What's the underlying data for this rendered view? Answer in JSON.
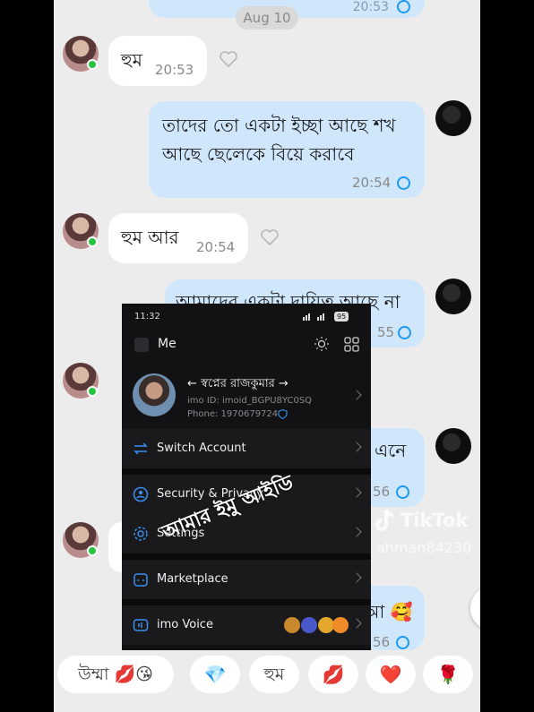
{
  "chat": {
    "date_label": "Aug 10",
    "top_bubble_time": "20:53",
    "messages": [
      {
        "text": "হুম",
        "time": "20:53"
      },
      {
        "line1": "তাদের তো একটা ইচ্ছা আছে শখ",
        "line2": "আছে ছেলেকে বিয়ে করাবে",
        "time": "20:54"
      },
      {
        "text": "হুম আর",
        "time": "20:54"
      },
      {
        "text": "আমাদের একটা দায়িত্ব আছে না",
        "time": "55"
      },
      {
        "text": "এনে",
        "time": "56"
      },
      {
        "text": "আ 🥰",
        "time": "56"
      }
    ],
    "quick_replies": [
      "উম্মা 💋😘",
      "💎",
      "হুম",
      "💋",
      "❤️",
      "🌹"
    ]
  },
  "overlay": {
    "status_time": "11:32",
    "battery": "95",
    "header_title": "Me",
    "profile_name": "← স্বপ্নের রাজকুমার →",
    "imo_id": "imo ID: imoid_BGPU8YC0SQ",
    "phone": "Phone: 1970679724",
    "menu": {
      "switch_account": "Switch Account",
      "security_privacy": "Security & Privacy",
      "settings": "Settings",
      "marketplace": "Marketplace",
      "imo_voice": "imo Voice"
    },
    "caption": "আমার ইমু আইডি"
  },
  "watermark": {
    "brand": "TikTok",
    "handle": "ahman84230"
  },
  "colors": {
    "incoming_bubble": "#ffffff",
    "outgoing_bubble": "#cfe6fb",
    "read_tick": "#1e9bf0",
    "online_dot": "#27c53f",
    "overlay_bg": "#121214",
    "caption": "#ffffff"
  }
}
